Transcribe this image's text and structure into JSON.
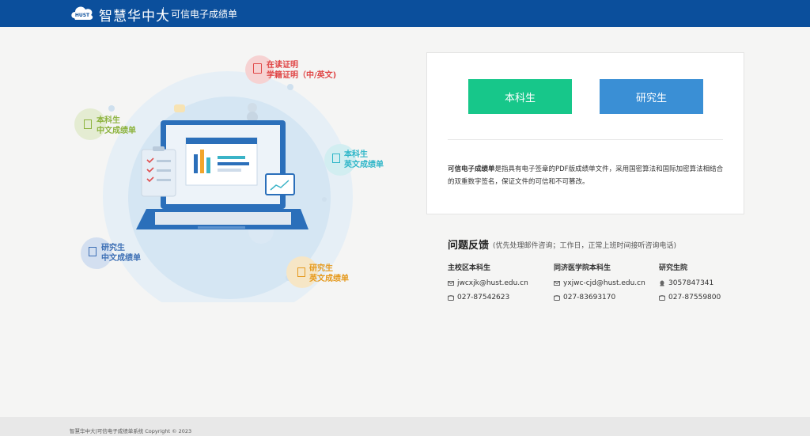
{
  "header": {
    "logo_badge": "HUST",
    "logo_text": "智慧华中大",
    "title": "可信电子成绩单",
    "background": "#0b4f9c"
  },
  "illustration": {
    "tags": [
      {
        "line1": "在读证明",
        "line2": "学籍证明（中/英文)",
        "color": "#e04848",
        "icon": "certificate-icon"
      },
      {
        "line1": "本科生",
        "line2": "中文成绩单",
        "color": "#8db33e",
        "icon": "document-icon"
      },
      {
        "line1": "本科生",
        "line2": "英文成绩单",
        "color": "#2fb6c8",
        "icon": "document-icon"
      },
      {
        "line1": "研究生",
        "line2": "中文成绩单",
        "color": "#3d6fb5",
        "icon": "document-icon"
      },
      {
        "line1": "研究生",
        "line2": "英文成绩单",
        "color": "#e59a1f",
        "icon": "document-icon"
      }
    ]
  },
  "card": {
    "undergrad_button": "本科生",
    "grad_button": "研究生",
    "desc_bold": "可信电子成绩单",
    "desc_rest": "是指具有电子签章的PDF版成绩单文件，采用国密算法和国际加密算法相结合的双重数字签名，保证文件的可信和不可篡改。",
    "colors": {
      "undergrad": "#17c78a",
      "grad": "#3a8fd5"
    }
  },
  "feedback": {
    "title": "问题反馈",
    "note": "(优先处理邮件咨询；工作日，正常上班时间接听咨询电话)",
    "columns": [
      {
        "title": "主校区本科生",
        "rows": [
          {
            "icon": "mail-icon",
            "text": "jwcxjk@hust.edu.cn"
          },
          {
            "icon": "phone-icon",
            "text": "027-87542623"
          }
        ]
      },
      {
        "title": "同济医学院本科生",
        "rows": [
          {
            "icon": "mail-icon",
            "text": "yxjwc-cjd@hust.edu.cn"
          },
          {
            "icon": "phone-icon",
            "text": "027-83693170"
          }
        ]
      },
      {
        "title": "研究生院",
        "rows": [
          {
            "icon": "qq-icon",
            "text": "3057847341"
          },
          {
            "icon": "phone-icon",
            "text": "027-87559800"
          }
        ]
      }
    ]
  },
  "footer": {
    "text": "智慧华中大|可信电子成绩单系统 Copyright © 2023"
  }
}
